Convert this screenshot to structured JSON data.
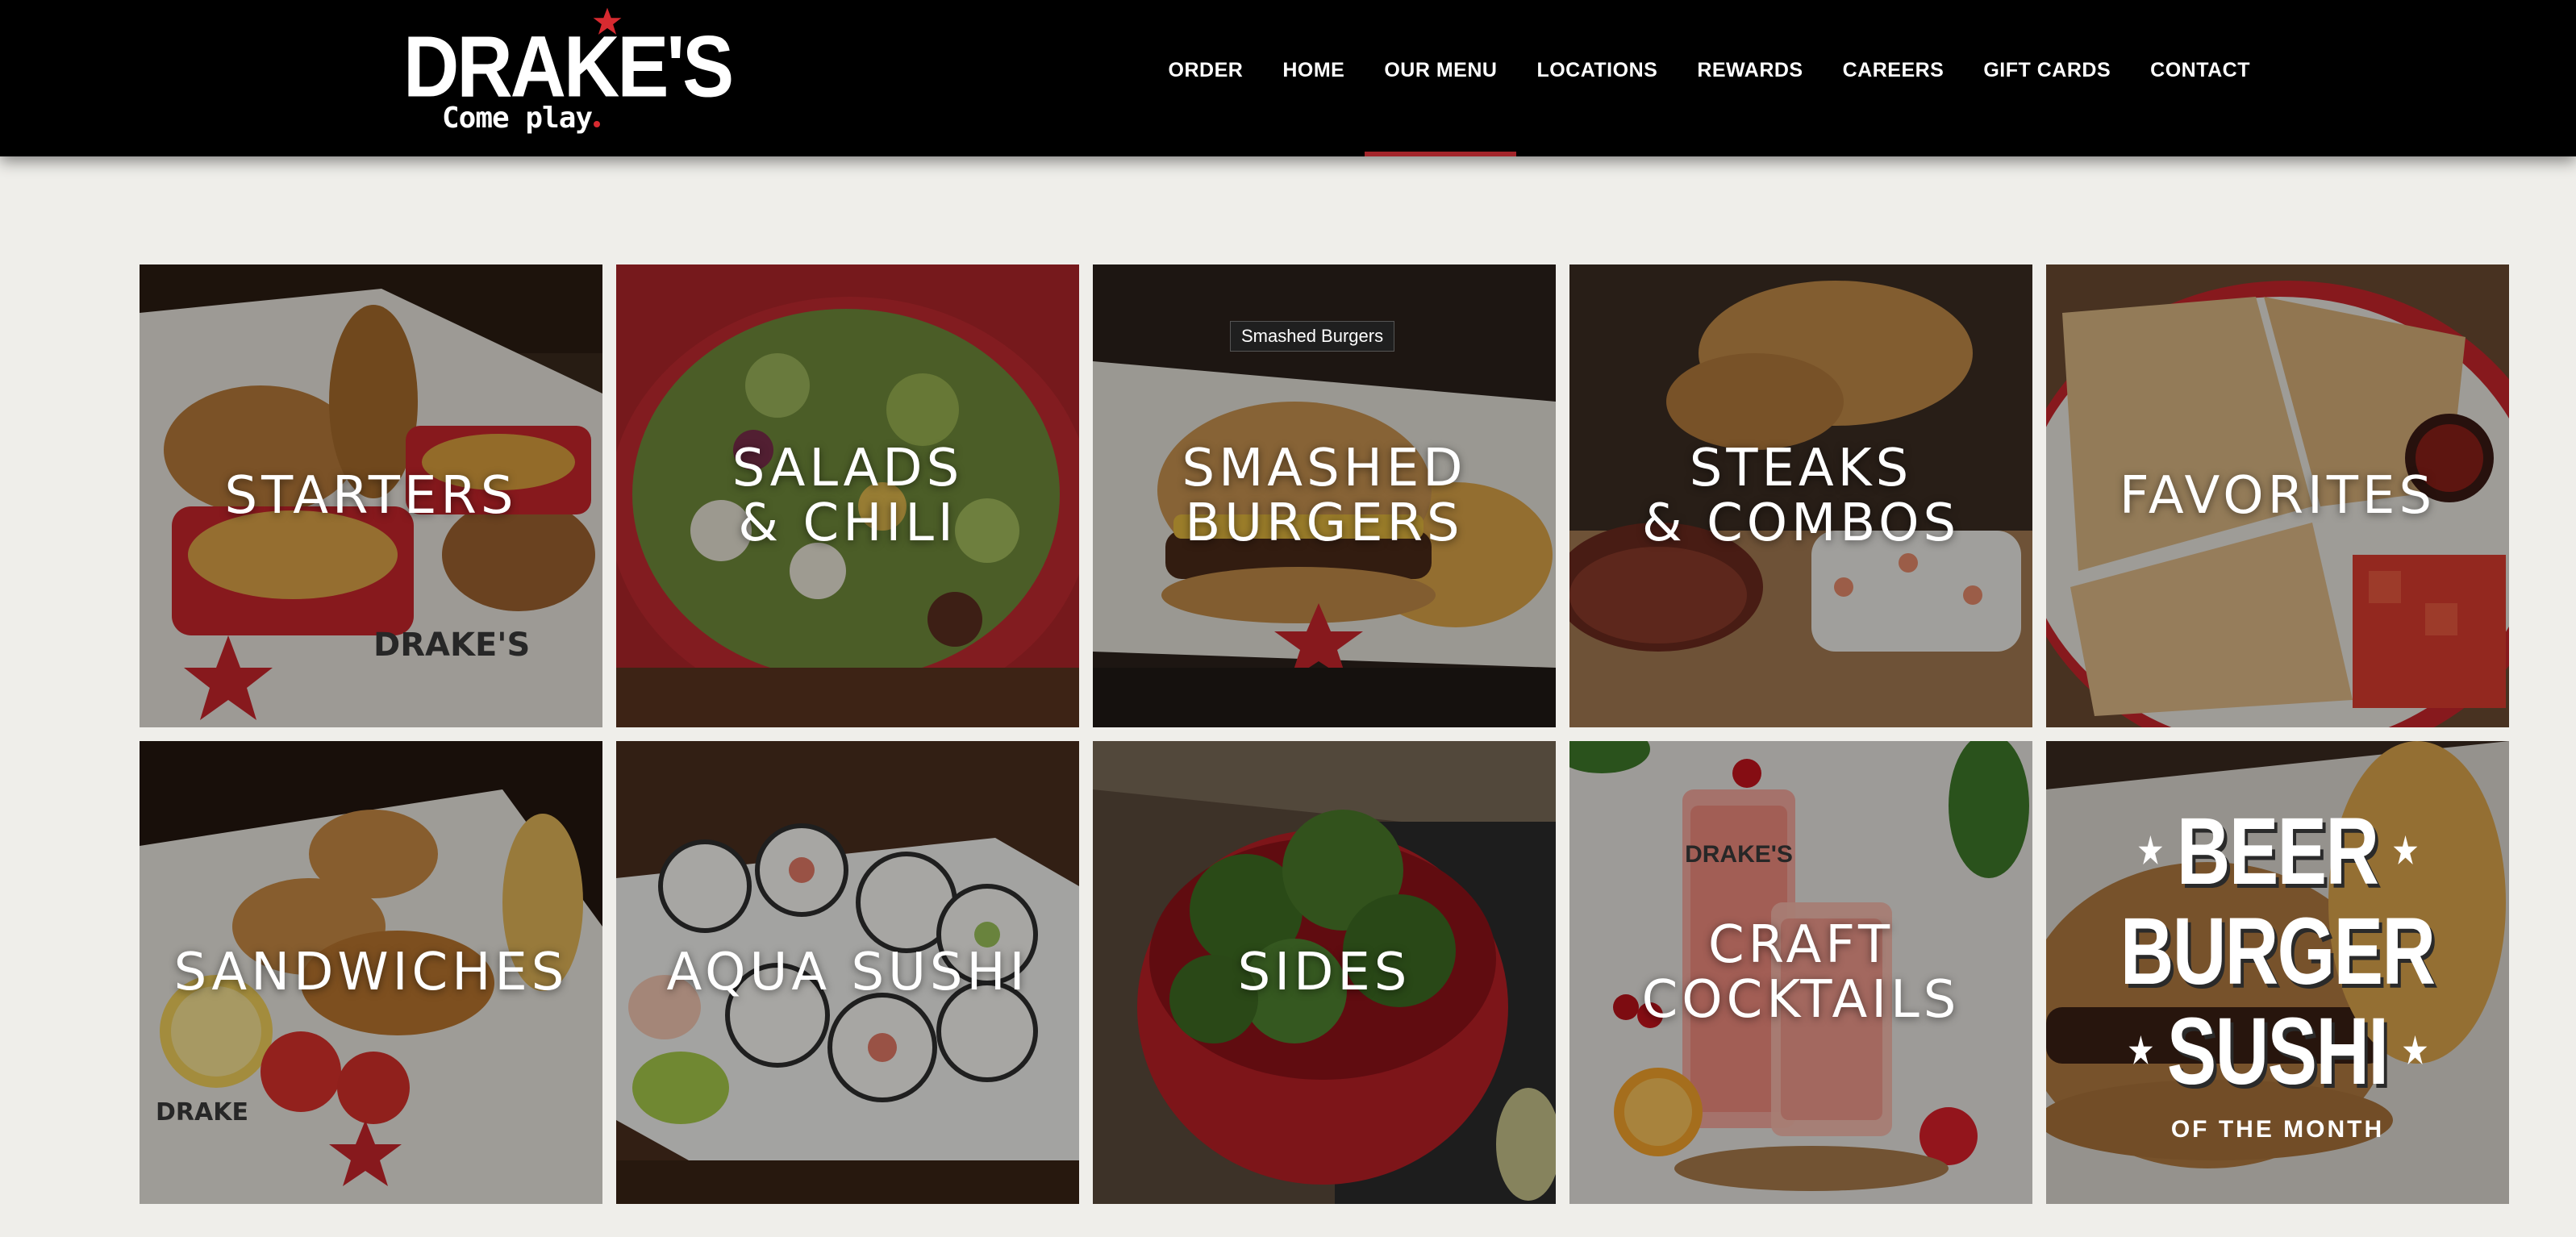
{
  "header": {
    "logo": {
      "wordmark": "DRAKE'S",
      "tagline": "Come play",
      "star_color": "#d72a30"
    },
    "nav": [
      {
        "label": "ORDER",
        "active": false
      },
      {
        "label": "HOME",
        "active": false
      },
      {
        "label": "OUR MENU",
        "active": true
      },
      {
        "label": "LOCATIONS",
        "active": false
      },
      {
        "label": "REWARDS",
        "active": false
      },
      {
        "label": "CAREERS",
        "active": false
      },
      {
        "label": "GIFT CARDS",
        "active": false
      },
      {
        "label": "CONTACT",
        "active": false
      }
    ],
    "active_indicator_color": "#a3242a"
  },
  "menu": {
    "tiles": [
      {
        "title": "STARTERS",
        "photo": "pretzels-and-queso"
      },
      {
        "title": "SALADS\n& CHILI",
        "photo": "salad-bowl"
      },
      {
        "title": "SMASHED\nBURGERS",
        "photo": "smashed-burger-and-fries",
        "tooltip": "Smashed Burgers"
      },
      {
        "title": "STEAKS\n& COMBOS",
        "photo": "steak-and-sushi"
      },
      {
        "title": "FAVORITES",
        "photo": "quesadilla"
      },
      {
        "title": "SANDWICHES",
        "photo": "chicken-sandwiches"
      },
      {
        "title": "AQUA SUSHI",
        "photo": "sushi-rolls"
      },
      {
        "title": "SIDES",
        "photo": "broccoli-bowl"
      },
      {
        "title": "CRAFT\nCOCKTAILS",
        "photo": "pink-cocktails",
        "glass_print": "DRAKE'S"
      },
      {
        "title": "",
        "photo": "burger-and-fries",
        "promo": {
          "lines": [
            "BEER",
            "BURGER",
            "SUSHI"
          ],
          "sub": "OF THE MONTH"
        }
      }
    ]
  },
  "colors": {
    "header_bg": "#000000",
    "page_bg": "#efeeea",
    "brand_red": "#d72a30"
  }
}
